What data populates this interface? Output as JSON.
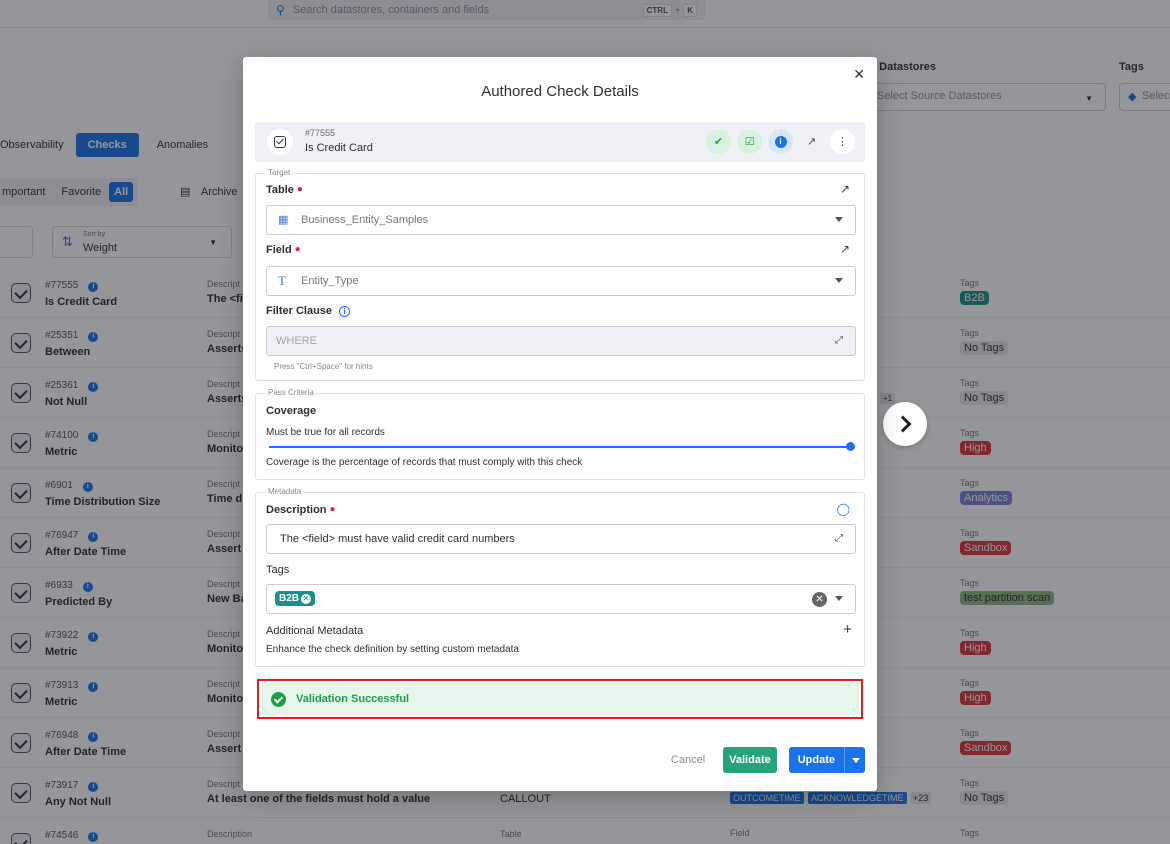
{
  "search": {
    "placeholder": "Search datastores, containers and fields",
    "kbd1": "CTRL",
    "plus": "+",
    "kbd2": "K"
  },
  "filters_top": {
    "source_label": "e Datastores",
    "source_placeholder": "Select Source Datastores",
    "tags_label": "Tags",
    "tags_placeholder": "Selec"
  },
  "nav_tabs": [
    "Observability",
    "Checks",
    "Anomalies"
  ],
  "quick_filters": [
    "mportant",
    "Favorite",
    "All"
  ],
  "archived_label": "Archive",
  "sort": {
    "caption": "Sort by",
    "value": "Weight"
  },
  "rows": [
    {
      "id": "#77555",
      "name": "Is Credit Card",
      "dlabel": "Descript",
      "dval": "The <fi",
      "tag": "B2B",
      "tag_bg": "#1d8f8a",
      "tag_fg": "#ffffff"
    },
    {
      "id": "#25351",
      "name": "Between",
      "dlabel": "Descript",
      "dval": "Asserts",
      "tag": "No Tags",
      "tag_bg": "#e5e7eb",
      "tag_fg": "#333333"
    },
    {
      "id": "#25361",
      "name": "Not Null",
      "dlabel": "Descript",
      "dval": "Asserts",
      "tag": "No Tags",
      "tag_bg": "#e5e7eb",
      "tag_fg": "#333333"
    },
    {
      "id": "#74100",
      "name": "Metric",
      "dlabel": "Descript",
      "dval": "Monito",
      "tag": "High",
      "tag_bg": "#d9363e",
      "tag_fg": "#ffffff"
    },
    {
      "id": "#6901",
      "name": "Time Distribution Size",
      "dlabel": "Descript",
      "dval": "Time di",
      "tag": "Analytics",
      "tag_bg": "#7b80d6",
      "tag_fg": "#ffffff"
    },
    {
      "id": "#76947",
      "name": "After Date Time",
      "dlabel": "Descript",
      "dval": "Assert t",
      "tag": "Sandbox",
      "tag_bg": "#d9363e",
      "tag_fg": "#ffffff"
    },
    {
      "id": "#6933",
      "name": "Predicted By",
      "dlabel": "Descript",
      "dval": "New Ba",
      "tag": "test partition scan",
      "tag_bg": "#93b58a",
      "tag_fg": "#1e3a17"
    },
    {
      "id": "#73922",
      "name": "Metric",
      "dlabel": "Descript",
      "dval": "Monito",
      "tag": "High",
      "tag_bg": "#d9363e",
      "tag_fg": "#ffffff"
    },
    {
      "id": "#73913",
      "name": "Metric",
      "dlabel": "Descript",
      "dval": "Monito",
      "tag": "High",
      "tag_bg": "#d9363e",
      "tag_fg": "#ffffff"
    },
    {
      "id": "#76948",
      "name": "After Date Time",
      "dlabel": "Descript",
      "dval": "Assert t",
      "tag": "Sandbox",
      "tag_bg": "#d9363e",
      "tag_fg": "#ffffff"
    },
    {
      "id": "#73917",
      "name": "Any Not Null",
      "dlabel": "Descript",
      "dval": "At least one of the fields must hold a value",
      "tag": "No Tags",
      "tag_bg": "#e5e7eb",
      "tag_fg": "#333333"
    },
    {
      "id": "#74546",
      "name": "",
      "dlabel": "Description",
      "dval": "",
      "tag": "",
      "tag_bg": "#d9363e",
      "tag_fg": "#ffffff"
    }
  ],
  "row_extras": {
    "callout": "CALLOUT",
    "field_chip1": "OUTCOMETIME",
    "field_chip2": "ACKNOWLEDGETIME",
    "more": "+23",
    "more_small": "+1",
    "tags_col": "Tags",
    "table_col": "Table",
    "field_col": "Field"
  },
  "modal": {
    "title": "Authored Check Details",
    "check_id": "#77555",
    "check_name": "Is Credit Card",
    "target_legend": "Target",
    "table_label": "Table",
    "table_value": "Business_Entity_Samples",
    "field_label": "Field",
    "field_value": "Entity_Type",
    "filter_label": "Filter Clause",
    "filter_placeholder": "WHERE",
    "filter_hint": "Press \"Ctrl+Space\" for hints",
    "pass_legend": "Pass Criteria",
    "coverage_label": "Coverage",
    "coverage_text": "Must be true for all records",
    "coverage_fraction": 1.0,
    "coverage_help": "Coverage is the percentage of records that must comply with this check",
    "metadata_legend": "Metadata",
    "description_label": "Description",
    "description_value": "The <field> must have valid credit card numbers",
    "tags_label": "Tags",
    "tag_chip": "B2B",
    "additional_label": "Additional Metadata",
    "additional_help": "Enhance the check definition by setting custom metadata",
    "validation_message": "Validation Successful",
    "cancel": "Cancel",
    "validate": "Validate",
    "update": "Update"
  },
  "colors": {
    "accent": "#1a73e8",
    "success": "#1e9e4a",
    "validate_bg": "#25a37d",
    "highlight_border": "#e11d1d"
  }
}
